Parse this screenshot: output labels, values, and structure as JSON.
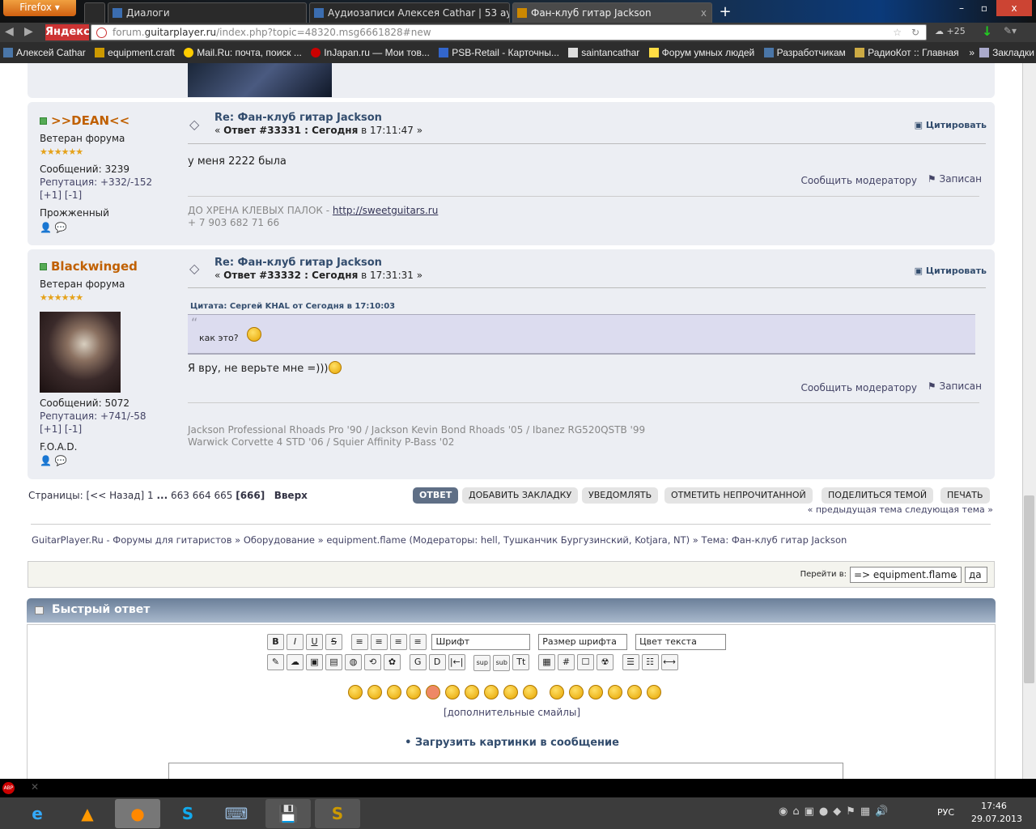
{
  "browser": {
    "menu": "Firefox",
    "tabs": [
      {
        "label": "Диалоги"
      },
      {
        "label": "Аудиозаписи Алексея Cathar | 53 ау..."
      },
      {
        "label": "Фан-клуб гитар Jackson",
        "close": "x"
      }
    ],
    "new_tab": "+",
    "search_brand": "Яндекс",
    "url_prefix": "forum.",
    "url_domain": "guitarplayer.ru",
    "url_path": "/index.php?topic=48320.msg6661828#new",
    "weather": "+25",
    "bookmarks": [
      "Алексей Cathar",
      "equipment.craft",
      "Mail.Ru: почта, поиск ...",
      "InJapan.ru — Мои тов...",
      "PSB-Retail - Карточны...",
      "saintancathar",
      "Форум умных людей",
      "Разработчикам",
      "РадиоКот :: Главная"
    ],
    "bookmarks_more": "»",
    "bookmarks_folder": "Закладки"
  },
  "posts": [
    {
      "author": "&gt;&gt;DEAN&lt;&lt;",
      "author_text": ">>DEAN<<",
      "rank": "Ветеран форума",
      "stars": "★★★★★★",
      "posts": "Сообщений: 3239",
      "reputation": "Репутация: +332/-152",
      "rep_plus": "[+1]",
      "rep_minus": "[-1]",
      "personal": "Прожженный",
      "title": "Re: Фан-клуб гитар Jackson",
      "reply_prefix": "« ",
      "reply_label": "Ответ #33331 : Сегодня",
      "reply_time": " в 17:11:47 »",
      "quote_btn": "Цитировать",
      "body": "у меня 2222 была",
      "report": "Сообщить модератору",
      "logged": "Записан",
      "sig_text": "ДО ХРЕНА КЛЕВЫХ ПАЛОК - ",
      "sig_link": "http://sweetguitars.ru",
      "sig_line2": "+ 7 903 682 71 66"
    },
    {
      "author_text": "Blackwinged",
      "rank": "Ветеран форума",
      "stars": "★★★★★★",
      "posts": "Сообщений: 5072",
      "reputation": "Репутация: +741/-58",
      "rep_plus": "[+1]",
      "rep_minus": "[-1]",
      "personal": "F.O.A.D.",
      "title": "Re: Фан-клуб гитар Jackson",
      "reply_prefix": "« ",
      "reply_label": "Ответ #33332 : Сегодня",
      "reply_time": " в 17:31:31 »",
      "quote_btn": "Цитировать",
      "quote_header": "Цитата: Сергей KHAL от Сегодня в 17:10:03",
      "quote_text": "как это?",
      "body": "Я вру, не верьте мне =)))",
      "report": "Сообщить модератору",
      "logged": "Записан",
      "sig_line1": "Jackson Professional Rhoads Pro '90 / Jackson Kevin Bond Rhoads '05 / Ibanez RG520QSTB '99",
      "sig_line2": "Warwick Corvette 4 STD '06 / Squier Affinity P-Bass '02"
    }
  ],
  "pagination": {
    "label": "Страницы: ",
    "prev": "[<< Назад]",
    "p1": "1",
    "dots": "...",
    "p663": "663",
    "p664": "664",
    "p665": "665",
    "current": "[666]",
    "top": "Вверх"
  },
  "actions": [
    "ОТВЕТ",
    "ДОБАВИТЬ ЗАКЛАДКУ",
    "УВЕДОМЛЯТЬ",
    "ОТМЕТИТЬ НЕПРОЧИТАННОЙ",
    "ПОДЕЛИТЬСЯ ТЕМОЙ",
    "ПЕЧАТЬ"
  ],
  "topic_nav": {
    "prev": "« предыдущая тема",
    "next": "следующая тема »"
  },
  "breadcrumb": "GuitarPlayer.Ru - Форумы для гитаристов » Оборудование » equipment.flame (Модераторы: hell, Тушканчик Бургузинский, Kotjara, NT) » Тема: Фан-клуб гитар Jackson",
  "jump": {
    "label": "Перейти в:",
    "value": "=> equipment.flame",
    "go": "да"
  },
  "quick_reply": {
    "title": "Быстрый ответ",
    "font": "Шрифт",
    "size": "Размер шрифта",
    "color": "Цвет текста",
    "more_smileys": "[дополнительные смайлы]",
    "upload": "• Загрузить картинки в сообщение",
    "buttons": [
      "B",
      "I",
      "U",
      "S",
      "≡",
      "≡",
      "≡",
      "≡"
    ],
    "buttons2": [
      "✎",
      "☁",
      "▣",
      "▤",
      "◍",
      "⟲",
      "✿",
      "G",
      "D",
      "|←|",
      "sup",
      "sub",
      "Tt",
      "▦",
      "#",
      "☐",
      "☢",
      "☰",
      "☷",
      "⟷"
    ]
  },
  "taskbar": {
    "lang": "РУС",
    "time": "17:46",
    "date": "29.07.2013"
  }
}
